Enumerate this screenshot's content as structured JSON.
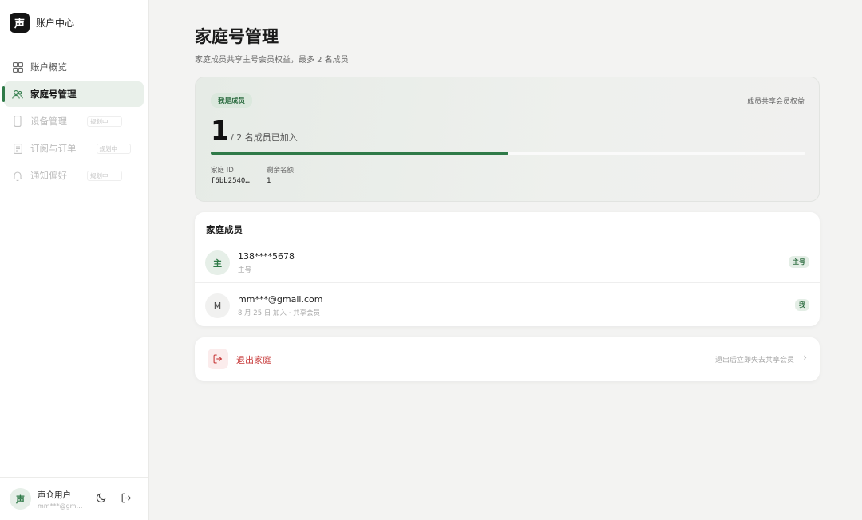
{
  "brand": {
    "logo": "声",
    "title": "账户中心"
  },
  "sidebar": {
    "items": [
      {
        "label": "账户概览",
        "icon": "grid-icon",
        "state": "normal"
      },
      {
        "label": "家庭号管理",
        "icon": "users-icon",
        "state": "active"
      },
      {
        "label": "设备管理",
        "icon": "phone-icon",
        "state": "disabled",
        "tag": "规划中"
      },
      {
        "label": "订阅与订单",
        "icon": "receipt-icon",
        "state": "disabled",
        "tag": "规划中"
      },
      {
        "label": "通知偏好",
        "icon": "bell-icon",
        "state": "disabled",
        "tag": "规划中"
      }
    ],
    "footer": {
      "avatar": "声",
      "name": "声仓用户",
      "email": "mm***@gmail.com"
    }
  },
  "page": {
    "title": "家庭号管理",
    "subtitle": "家庭成员共享主号会员权益，最多 2 名成员"
  },
  "stats": {
    "badge": "我是成员",
    "right_label": "成员共享会员权益",
    "count": "1",
    "total_text": "/ 2 名成员已加入",
    "progress_fraction": 0.5,
    "family_id_label": "家庭 ID",
    "family_id_value": "f6bb2540…",
    "remaining_label": "剩余名额",
    "remaining_value": "1"
  },
  "members": {
    "title": "家庭成员",
    "list": [
      {
        "avatar": "主",
        "name": "138****5678",
        "sub": "主号",
        "badge": "主号"
      },
      {
        "avatar": "M",
        "name": "mm***@gmail.com",
        "sub": "8 月 25 日 加入 · 共享会员",
        "badge": "我"
      }
    ]
  },
  "exit": {
    "label": "退出家庭",
    "hint": "退出后立即失去共享会员",
    "chevron": "›"
  },
  "colors": {
    "accent": "#2f7a48",
    "danger": "#c83c3c"
  }
}
